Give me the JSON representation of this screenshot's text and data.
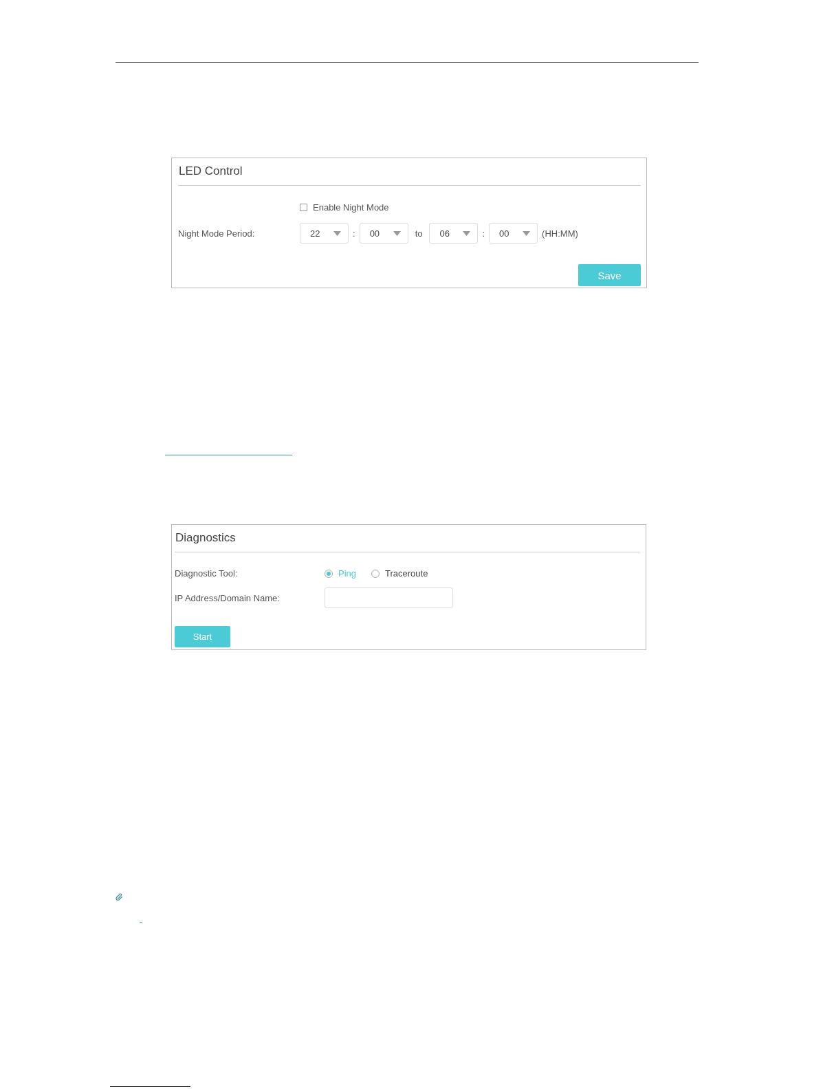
{
  "led_control": {
    "title": "LED Control",
    "enable_night_mode": {
      "label": "Enable Night Mode",
      "checked": false
    },
    "period_label": "Night Mode Period:",
    "time_fields": [
      {
        "kind": "select",
        "value": "22"
      },
      {
        "kind": "text",
        "value": ":"
      },
      {
        "kind": "select",
        "value": "00"
      },
      {
        "kind": "text",
        "value": "to"
      },
      {
        "kind": "select",
        "value": "06"
      },
      {
        "kind": "text",
        "value": ":"
      },
      {
        "kind": "select",
        "value": "00"
      },
      {
        "kind": "text",
        "value": "(HH:MM)"
      }
    ],
    "save_button": "Save"
  },
  "diagnostics": {
    "title": "Diagnostics",
    "tool_label": "Diagnostic Tool:",
    "tools": [
      {
        "label": "Ping",
        "selected": true
      },
      {
        "label": "Traceroute",
        "selected": false
      }
    ],
    "address_label": "IP Address/Domain Name:",
    "start_button": "Start"
  }
}
